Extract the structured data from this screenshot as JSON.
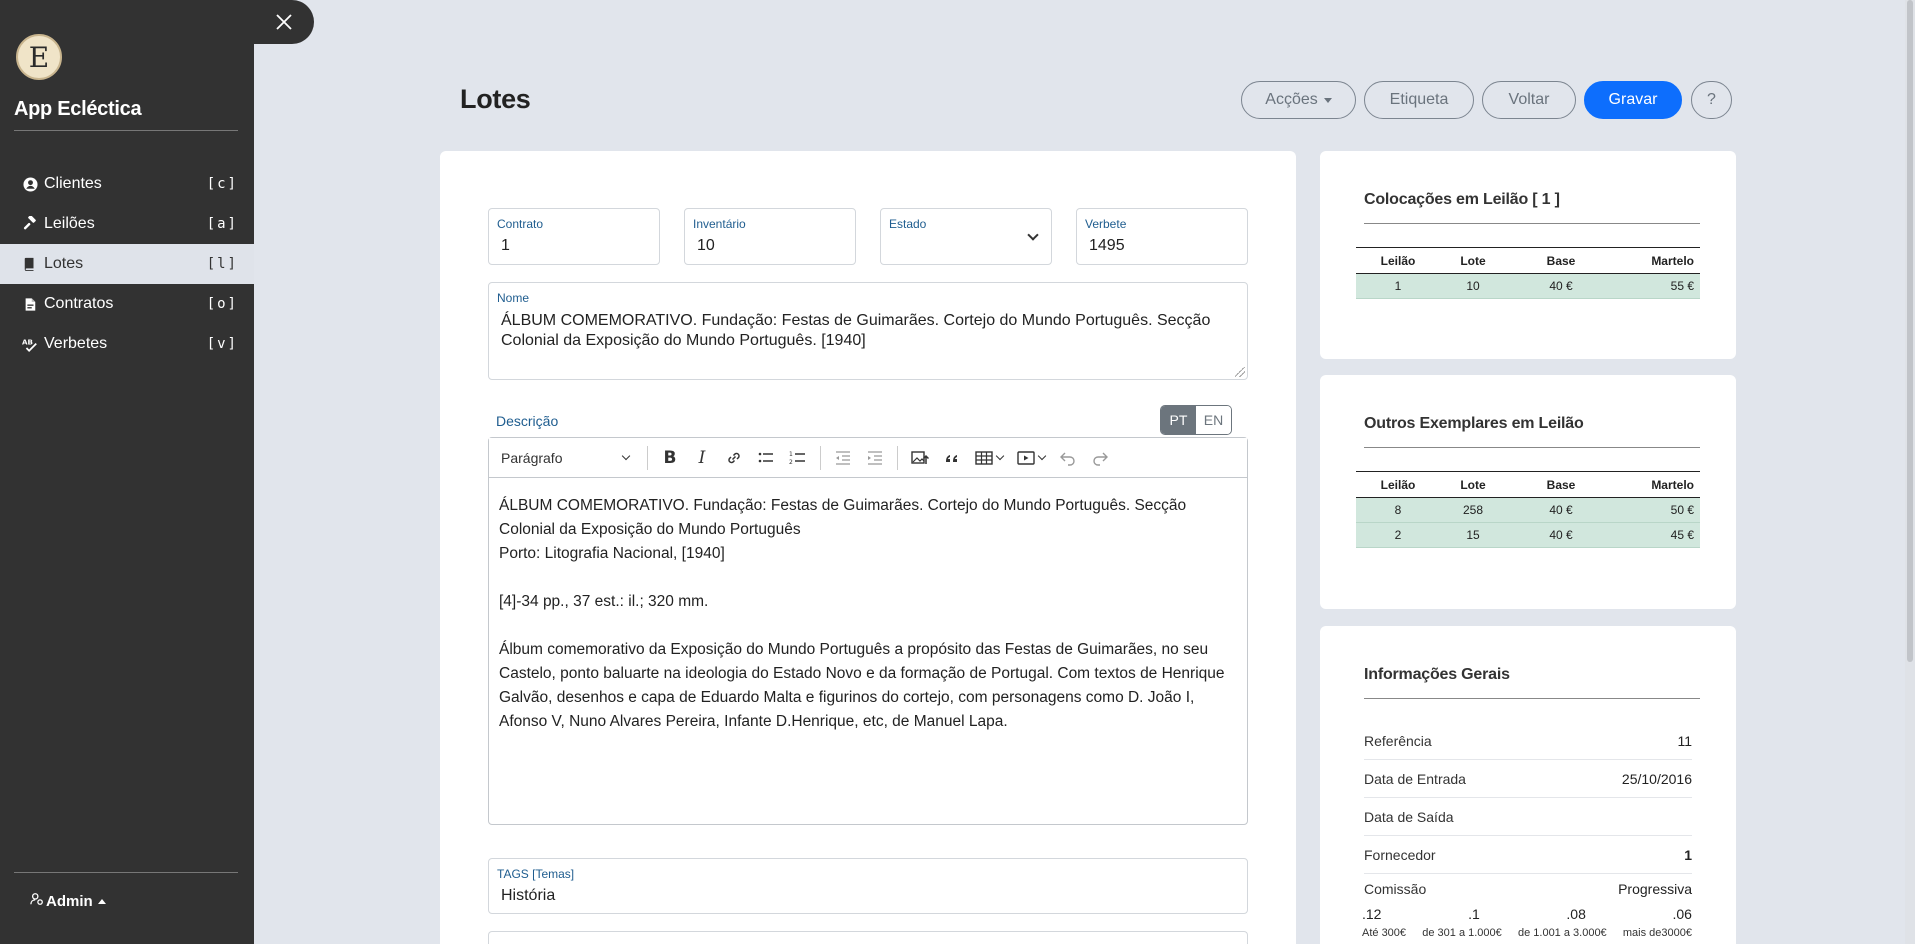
{
  "app": {
    "title": "App Ecléctica",
    "logo_letter": "E"
  },
  "sidebar": {
    "items": [
      {
        "label": "Clientes",
        "key": "[c]",
        "icon": "user-circle-icon"
      },
      {
        "label": "Leilões",
        "key": "[a]",
        "icon": "gavel-icon"
      },
      {
        "label": "Lotes",
        "key": "[l]",
        "icon": "book-icon",
        "active": true
      },
      {
        "label": "Contratos",
        "key": "[o]",
        "icon": "file-pdf-icon"
      },
      {
        "label": "Verbetes",
        "key": "[v]",
        "icon": "spell-check-icon"
      }
    ],
    "user": "Admin"
  },
  "header": {
    "title": "Lotes",
    "buttons": {
      "acoes": "Acções",
      "etiqueta": "Etiqueta",
      "voltar": "Voltar",
      "gravar": "Gravar",
      "help": "?"
    }
  },
  "form": {
    "contrato": {
      "label": "Contrato",
      "value": "1"
    },
    "inventario": {
      "label": "Inventário",
      "value": "10"
    },
    "estado": {
      "label": "Estado",
      "value": ""
    },
    "verbete": {
      "label": "Verbete",
      "value": "1495"
    },
    "nome": {
      "label": "Nome",
      "value": "ÁLBUM COMEMORATIVO. Fundação: Festas de Guimarães. Cortejo do Mundo Português. Secção Colonial da Exposição do Mundo Português. [1940]"
    },
    "descricao": {
      "label": "Descrição",
      "lang_pt": "PT",
      "lang_en": "EN",
      "toolbar_paragraph": "Parágrafo",
      "lines": [
        "ÁLBUM COMEMORATIVO. Fundação: Festas de Guimarães. Cortejo do Mundo Português. Secção Colonial da Exposição do Mundo Português",
        "Porto: Litografia Nacional, [1940]",
        "[4]-34 pp., 37 est.: il.; 320 mm.",
        "Álbum comemorativo da Exposição do Mundo Português a propósito das Festas de Guimarães, no seu Castelo, ponto baluarte na ideologia do Estado Novo e da formação de Portugal. Com textos de Henrique Galvão, desenhos e capa de Eduardo Malta e figurinos do cortejo, com personagens como D. João I, Afonso V, Nuno Alvares Pereira, Infante D.Henrique, etc, de Manuel Lapa."
      ]
    },
    "tags": {
      "label": "TAGS [Temas]",
      "value": "História"
    }
  },
  "colocacoes": {
    "title": "Colocações em Leilão [ 1 ]",
    "headers": [
      "Leilão",
      "Lote",
      "Base",
      "Martelo"
    ],
    "rows": [
      [
        "1",
        "10",
        "40 €",
        "55 €"
      ]
    ]
  },
  "outros": {
    "title": "Outros Exemplares em Leilão",
    "headers": [
      "Leilão",
      "Lote",
      "Base",
      "Martelo"
    ],
    "rows": [
      [
        "8",
        "258",
        "40 €",
        "50 €"
      ],
      [
        "2",
        "15",
        "40 €",
        "45 €"
      ]
    ]
  },
  "info": {
    "title": "Informações Gerais",
    "rows": [
      {
        "label": "Referência",
        "value": "11"
      },
      {
        "label": "Data de Entrada",
        "value": "25/10/2016"
      },
      {
        "label": "Data de Saída",
        "value": ""
      },
      {
        "label": "Fornecedor",
        "value": "1"
      },
      {
        "label": "Comissão",
        "value": "Progressiva"
      }
    ],
    "commission_rates": [
      ".12",
      ".1",
      ".08",
      ".06"
    ],
    "commission_tiers": [
      "Até 300€",
      "de 301 a 1.000€",
      "de 1.001 a 3.000€",
      "mais de3000€"
    ]
  }
}
